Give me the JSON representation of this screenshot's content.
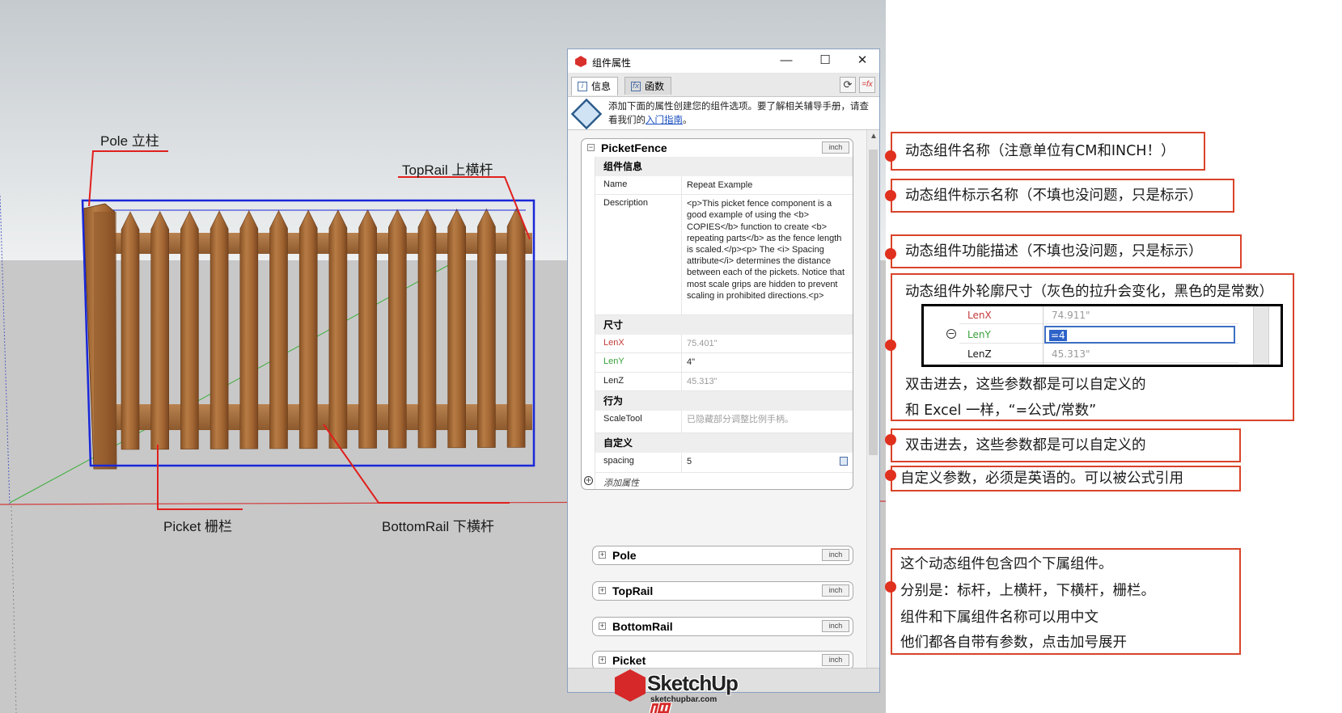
{
  "viewport": {
    "labels": {
      "pole": "Pole 立柱",
      "toprail": "TopRail 上横杆",
      "picket": "Picket 栅栏",
      "bottomrail": "BottomRail 下横杆"
    },
    "colors": {
      "callout_line": "#e0201e",
      "selection_box": "#1a28d8",
      "wood": "#a66a35"
    }
  },
  "window": {
    "title": "组件属性",
    "controls": {
      "minimize": "—",
      "maximize": "☐",
      "close": "✕"
    },
    "tabs": [
      {
        "label": "信息",
        "active": true
      },
      {
        "label": "函数",
        "active": false
      }
    ],
    "toolbar": {
      "refresh_icon": "refresh-icon",
      "formula_icon": "fx-icon"
    },
    "hint": {
      "text": "添加下面的属性创建您的组件选项。要了解相关辅导手册，请查看我们的",
      "link": "入门指南",
      "tail": "。"
    },
    "main_group": {
      "name": "PicketFence",
      "unit": "inch",
      "sections": {
        "info": "组件信息",
        "size": "尺寸",
        "behavior": "行为",
        "custom": "自定义"
      },
      "info_rows": [
        {
          "key": "Name",
          "value": "Repeat Example"
        },
        {
          "key": "Description",
          "value": "<p>This picket fence component is a good example of using the <b> COPIES</b> function to create <b> repeating parts</b> as the fence length is scaled.</p><p> The <i> Spacing attribute</i> determines the distance between each of the pickets. Notice that most scale grips are hidden to prevent scaling in prohibited directions.<p>"
        }
      ],
      "size_rows": [
        {
          "key": "LenX",
          "value": "75.401\""
        },
        {
          "key": "LenY",
          "value": "4\""
        },
        {
          "key": "LenZ",
          "value": "45.313\""
        }
      ],
      "behavior_rows": [
        {
          "key": "ScaleTool",
          "value": "已隐藏部分调整比例手柄。"
        }
      ],
      "custom_rows": [
        {
          "key": "spacing",
          "value": "5"
        }
      ],
      "add_attribute": "添加属性"
    },
    "subgroups": [
      {
        "name": "Pole",
        "unit": "inch"
      },
      {
        "name": "TopRail",
        "unit": "inch"
      },
      {
        "name": "BottomRail",
        "unit": "inch"
      },
      {
        "name": "Picket",
        "unit": "inch"
      }
    ]
  },
  "logo": {
    "brand": "SketchUp",
    "brand_suffix": "吧",
    "site": "sketchupbar.com"
  },
  "notes": {
    "n1": "动态组件名称（注意单位有CM和INCH！）",
    "n2": "动态组件标示名称（不填也没问题，只是标示）",
    "n3": "动态组件功能描述（不填也没问题，只是标示）",
    "n4": {
      "title": "动态组件外轮廓尺寸（灰色的拉升会变化，黑色的是常数）",
      "inset_rows": [
        {
          "key": "LenX",
          "value": "74.911\""
        },
        {
          "key": "LenY",
          "value": "=4"
        },
        {
          "key": "LenZ",
          "value": "45.313\""
        }
      ],
      "line1": "双击进去，这些参数都是可以自定义的",
      "line2": "和 Excel 一样，“=公式/常数”"
    },
    "n5": "双击进去，这些参数都是可以自定义的",
    "n6": "自定义参数，必须是英语的。可以被公式引用",
    "n7": [
      "这个动态组件包含四个下属组件。",
      "分别是：标杆，上横杆，下横杆，栅栏。",
      "组件和下属组件名称可以用中文",
      "他们都各自带有参数，点击加号展开"
    ]
  }
}
